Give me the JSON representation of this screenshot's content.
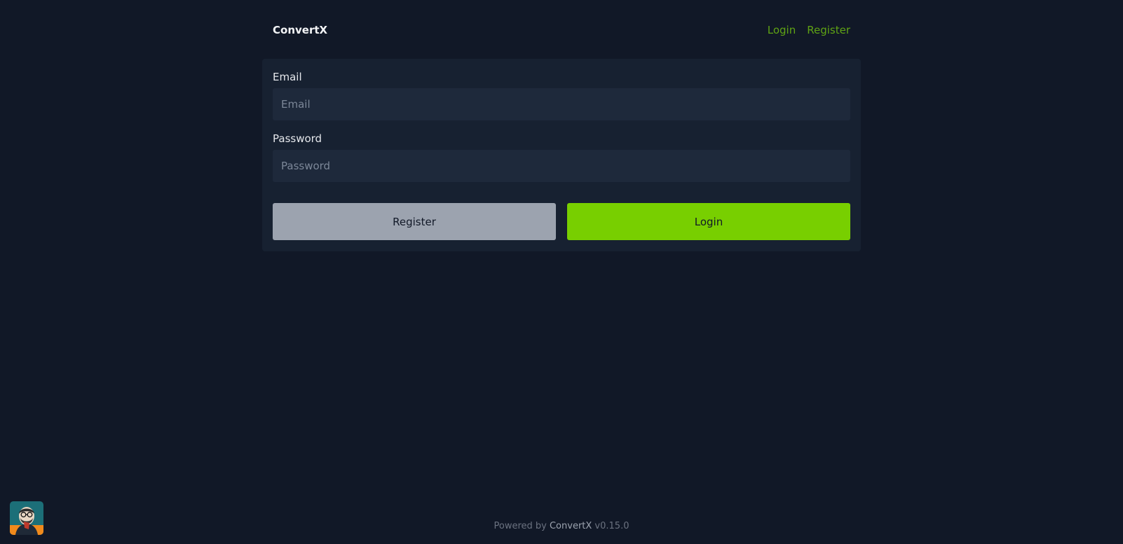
{
  "header": {
    "brand": "ConvertX",
    "nav": {
      "login": "Login",
      "register": "Register"
    }
  },
  "form": {
    "email_label": "Email",
    "email_placeholder": "Email",
    "email_value": "",
    "password_label": "Password",
    "password_placeholder": "Password",
    "password_value": "",
    "register_button": "Register",
    "login_button": "Login"
  },
  "footer": {
    "prefix": "Powered by ",
    "link": "ConvertX",
    "version": " v0.15.0"
  },
  "colors": {
    "background": "#111827",
    "card": "#172131",
    "input": "#1e293b",
    "accent": "#78cf00",
    "nav_link": "#5fa314",
    "secondary_button": "#9ca3af"
  },
  "icons": {
    "avatar": "user-avatar-icon"
  }
}
